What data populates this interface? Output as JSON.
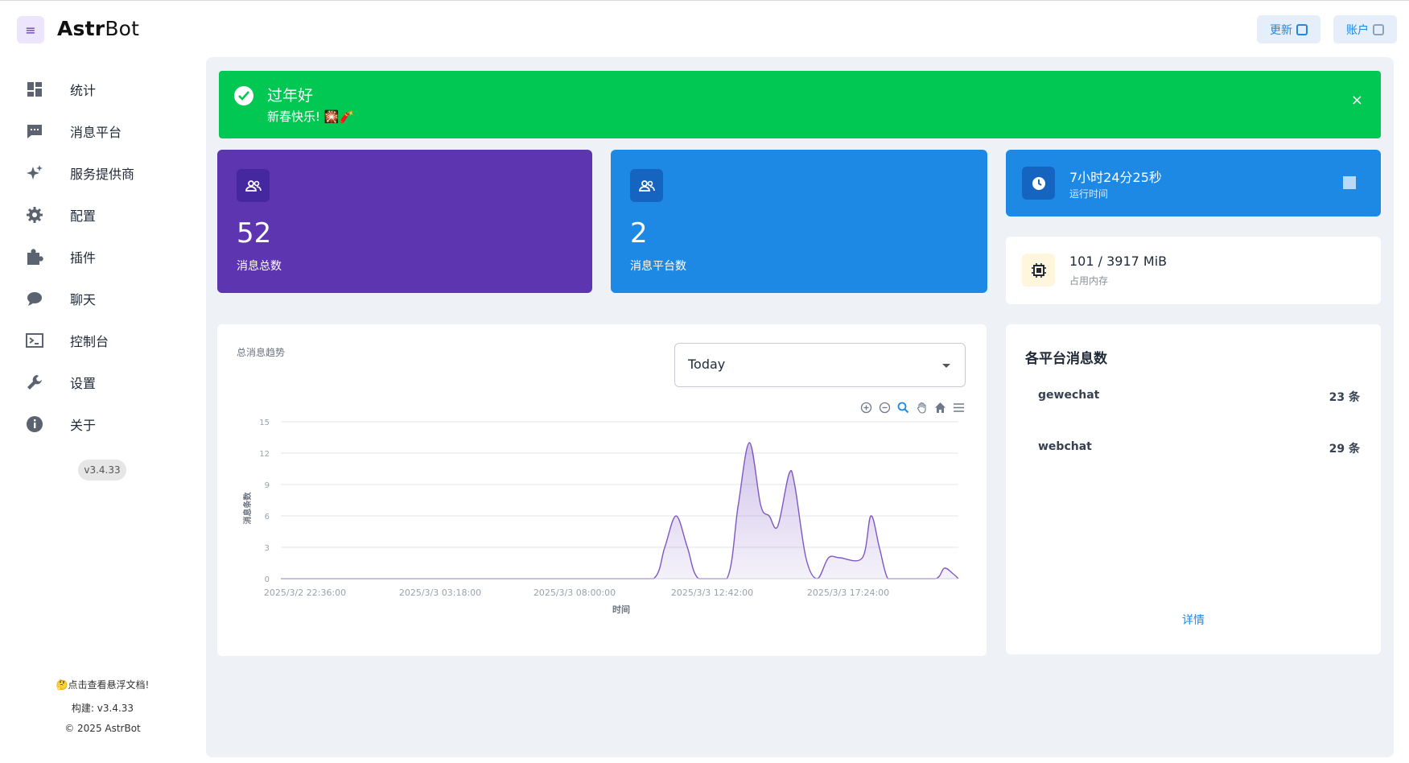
{
  "app": {
    "logo_bold": "Astr",
    "logo_rest": "Bot"
  },
  "header": {
    "update_label": "更新",
    "account_label": "账户"
  },
  "sidebar": {
    "items": [
      {
        "label": "统计",
        "icon": "dashboard-icon"
      },
      {
        "label": "消息平台",
        "icon": "message-icon"
      },
      {
        "label": "服务提供商",
        "icon": "sparkle-icon"
      },
      {
        "label": "配置",
        "icon": "gear-icon"
      },
      {
        "label": "插件",
        "icon": "puzzle-icon"
      },
      {
        "label": "聊天",
        "icon": "chat-icon"
      },
      {
        "label": "控制台",
        "icon": "terminal-icon"
      },
      {
        "label": "设置",
        "icon": "wrench-icon"
      },
      {
        "label": "关于",
        "icon": "info-icon"
      }
    ],
    "version": "v3.4.33",
    "docs_hint": "🤔点击查看悬浮文档!",
    "build": "构建: v3.4.33",
    "copyright": "© 2025 AstrBot"
  },
  "alert": {
    "title": "过年好",
    "text": "新春快乐! 🎇🧨",
    "close": "×"
  },
  "stats": {
    "total_messages": {
      "value": "52",
      "label": "消息总数"
    },
    "platforms": {
      "value": "2",
      "label": "消息平台数"
    },
    "uptime": {
      "value": "7小时24分25秒",
      "label": "运行时间"
    },
    "memory": {
      "value": "101 / 3917 MiB",
      "label": "占用内存"
    }
  },
  "colors": {
    "purple": "#5e35b1",
    "blue": "#1e88e5",
    "green": "#00c853",
    "bg": "#eef2f6"
  },
  "trend": {
    "title": "总消息趋势",
    "range_selected": "Today"
  },
  "chart_data": {
    "type": "area",
    "title": "总消息趋势",
    "xlabel": "时间",
    "ylabel": "消息条数",
    "ylim": [
      0,
      15
    ],
    "yticks": [
      0,
      3,
      6,
      9,
      12,
      15
    ],
    "xticks": [
      "2025/3/2 22:36:00",
      "2025/3/3 03:18:00",
      "2025/3/3 08:00:00",
      "2025/3/3 12:42:00",
      "2025/3/3 17:24:00"
    ],
    "grid": true,
    "color": "#7e57c2",
    "x_hours": [
      0,
      2,
      4,
      6,
      8,
      10,
      12,
      13.2,
      13.6,
      14,
      14.4,
      14.8,
      15.8,
      16.2,
      16.6,
      17,
      17.3,
      17.6,
      18,
      18.2,
      18.6,
      19,
      19.4,
      19.8,
      20.6,
      20.9,
      21.2,
      21.5,
      21.9,
      22.3,
      23.2,
      23.5,
      23.8,
      24
    ],
    "values": [
      0,
      0,
      0,
      0,
      0,
      0,
      0,
      0,
      3,
      6,
      3,
      0,
      0,
      7,
      13,
      7,
      6,
      5,
      10,
      9,
      2,
      0,
      2,
      2,
      2,
      6,
      3,
      0,
      0,
      0,
      0,
      1,
      0.5,
      0
    ]
  },
  "platform_counts": {
    "title": "各平台消息数",
    "rows": [
      {
        "name": "gewechat",
        "count": "23 条"
      },
      {
        "name": "webchat",
        "count": "29 条"
      }
    ],
    "detail": "详情"
  }
}
